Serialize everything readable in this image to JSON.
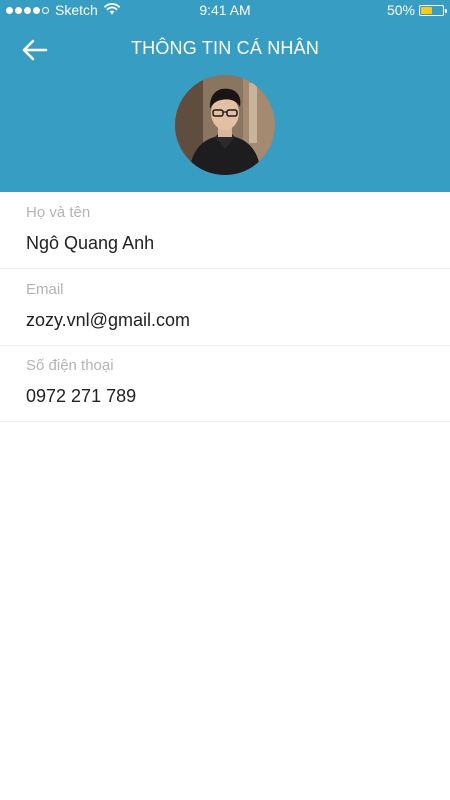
{
  "status_bar": {
    "carrier": "Sketch",
    "time": "9:41 AM",
    "battery": "50%",
    "battery_level": 0.5,
    "signal_bars": 4,
    "icons": [
      "signal-dots-icon",
      "wifi-icon",
      "battery-icon"
    ]
  },
  "header": {
    "title": "THÔNG TIN CÁ NHÂN",
    "back_icon": "arrow-left-icon"
  },
  "profile": {
    "avatar": "user-photo"
  },
  "fields": [
    {
      "label": "Họ và tên",
      "value": "Ngô Quang Anh"
    },
    {
      "label": "Email",
      "value": "zozy.vnl@gmail.com"
    },
    {
      "label": "Số điện thoại",
      "value": "0972 271 789"
    }
  ],
  "colors": {
    "header_bg": "#379dc3",
    "battery_fill": "#f7cd1c",
    "label": "#b3b3b3",
    "value": "#222222",
    "divider": "#ececec"
  }
}
